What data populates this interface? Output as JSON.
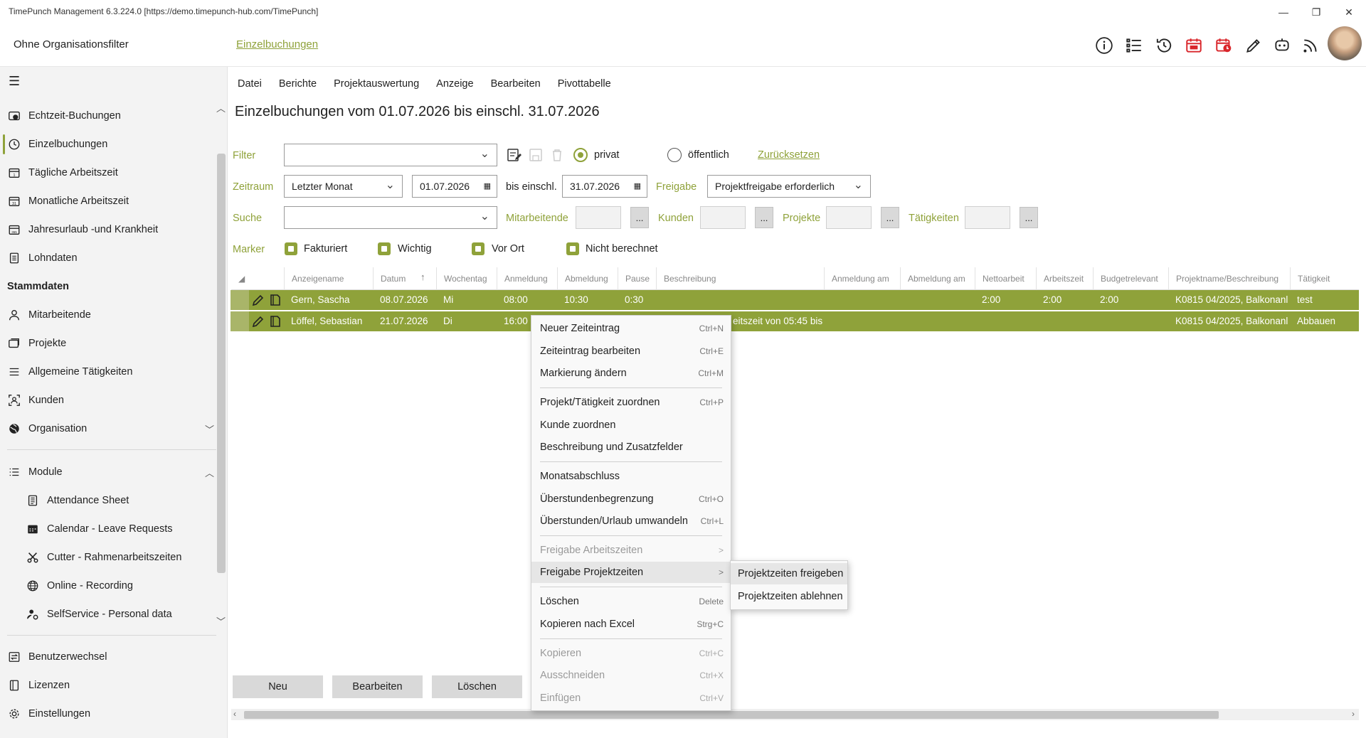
{
  "window": {
    "title": "TimePunch Management 6.3.224.0 [https://demo.timepunch-hub.com/TimePunch]",
    "buttons": [
      "—",
      "❐",
      "✕"
    ]
  },
  "header": {
    "org_filter": "Ohne Organisationsfilter",
    "breadcrumb": "Einzelbuchungen",
    "icons": [
      "info-icon",
      "list-icon",
      "history-icon",
      "calendar-alert-icon",
      "clock-alert-icon",
      "pencil-icon",
      "robot-icon",
      "rss-icon"
    ]
  },
  "sidebar": {
    "items": [
      {
        "label": "Echtzeit-Buchungen",
        "icon": "realtime-icon"
      },
      {
        "label": "Einzelbuchungen",
        "icon": "clock-icon"
      },
      {
        "label": "Tägliche Arbeitszeit",
        "icon": "calendar-day-icon"
      },
      {
        "label": "Monatliche Arbeitszeit",
        "icon": "calendar-month-icon"
      },
      {
        "label": "Jahresurlaub -und Krankheit",
        "icon": "calendar-year-icon"
      },
      {
        "label": "Lohndaten",
        "icon": "document-icon"
      }
    ],
    "stammdaten_header": "Stammdaten",
    "stammdaten": [
      {
        "label": "Mitarbeitende",
        "icon": "person-icon"
      },
      {
        "label": "Projekte",
        "icon": "projects-icon"
      },
      {
        "label": "Allgemeine Tätigkeiten",
        "icon": "list-icon"
      },
      {
        "label": "Kunden",
        "icon": "customer-icon"
      },
      {
        "label": "Organisation",
        "icon": "globe-icon"
      }
    ],
    "module_header": "Module",
    "modules": [
      {
        "label": "Attendance Sheet",
        "icon": "sheet-icon"
      },
      {
        "label": "Calendar - Leave Requests",
        "icon": "calendar-icon"
      },
      {
        "label": "Cutter - Rahmenarbeitszeiten",
        "icon": "scissors-icon"
      },
      {
        "label": "Online - Recording",
        "icon": "globe-icon"
      },
      {
        "label": "SelfService - Personal data",
        "icon": "person-gear-icon"
      }
    ],
    "bottom": [
      {
        "label": "Benutzerwechsel",
        "icon": "switch-user-icon"
      },
      {
        "label": "Lizenzen",
        "icon": "license-icon"
      },
      {
        "label": "Einstellungen",
        "icon": "gear-icon"
      }
    ]
  },
  "menu": [
    "Datei",
    "Berichte",
    "Projektauswertung",
    "Anzeige",
    "Bearbeiten",
    "Pivottabelle"
  ],
  "page_title": "Einzelbuchungen vom 01.07.2026 bis einschl. 31.07.2026",
  "filter": {
    "filter_label": "Filter",
    "filter_value": "",
    "radio_private": "privat",
    "radio_public": "öffentlich",
    "reset": "Zurücksetzen",
    "zeitraum_label": "Zeitraum",
    "zeitraum_value": "Letzter Monat",
    "date_from": "01.07.2026",
    "bis": "bis einschl.",
    "date_to": "31.07.2026",
    "freigabe_label": "Freigabe",
    "freigabe_value": "Projektfreigabe erforderlich",
    "suche_label": "Suche",
    "suche_value": "",
    "mitarbeitende_label": "Mitarbeitende",
    "kunden_label": "Kunden",
    "projekte_label": "Projekte",
    "taetigkeiten_label": "Tätigkeiten",
    "dots": "...",
    "marker_label": "Marker",
    "markers": [
      "Fakturiert",
      "Wichtig",
      "Vor Ort",
      "Nicht berechnet"
    ]
  },
  "grid": {
    "columns": [
      "Anzeigename",
      "Datum",
      "Wochentag",
      "Anmeldung",
      "Abmeldung",
      "Pause",
      "Beschreibung",
      "Anmeldung am",
      "Abmeldung am",
      "Nettoarbeit",
      "Arbeitszeit",
      "Budgetrelevant",
      "Projektname/Beschreibung",
      "Tätigkeit"
    ],
    "sort_arrow": "↑",
    "rows": [
      {
        "name": "Gern, Sascha",
        "date": "08.07.2026",
        "day": "Mi",
        "start": "08:00",
        "end": "10:30",
        "pause": "0:30",
        "desc": "",
        "netto": "2:00",
        "arbeit": "2:00",
        "budget": "2:00",
        "project": "K0815 04/2025, Balkonanl",
        "task": "test"
      },
      {
        "name": "Löffel, Sebastian",
        "date": "21.07.2026",
        "day": "Di",
        "start": "16:00",
        "end": "",
        "pause": "",
        "desc": "eitszeit von 05:45 bis ",
        "netto": "",
        "arbeit": "",
        "budget": "",
        "project": "K0815 04/2025, Balkonanl",
        "task": "Abbauen"
      }
    ]
  },
  "buttons": {
    "new": "Neu",
    "edit": "Bearbeiten",
    "delete": "Löschen"
  },
  "context_menu": {
    "items": [
      {
        "label": "Neuer Zeiteintrag",
        "shortcut": "Ctrl+N"
      },
      {
        "label": "Zeiteintrag bearbeiten",
        "shortcut": "Ctrl+E"
      },
      {
        "label": "Markierung ändern",
        "shortcut": "Ctrl+M"
      },
      {
        "label": "Projekt/Tätigkeit zuordnen",
        "shortcut": "Ctrl+P"
      },
      {
        "label": "Kunde zuordnen",
        "shortcut": ""
      },
      {
        "label": "Beschreibung und Zusatzfelder",
        "shortcut": ""
      },
      {
        "label": "Monatsabschluss",
        "shortcut": ""
      },
      {
        "label": "Überstundenbegrenzung",
        "shortcut": "Ctrl+O"
      },
      {
        "label": "Überstunden/Urlaub umwandeln",
        "shortcut": "Ctrl+L"
      },
      {
        "label": "Freigabe Arbeitszeiten",
        "shortcut": ">"
      },
      {
        "label": "Freigabe Projektzeiten",
        "shortcut": ">"
      },
      {
        "label": "Löschen",
        "shortcut": "Delete"
      },
      {
        "label": "Kopieren nach Excel",
        "shortcut": "Strg+C"
      },
      {
        "label": "Kopieren",
        "shortcut": "Ctrl+C"
      },
      {
        "label": "Ausschneiden",
        "shortcut": "Ctrl+X"
      },
      {
        "label": "Einfügen",
        "shortcut": "Ctrl+V"
      }
    ],
    "submenu": [
      "Projektzeiten freigeben",
      "Projektzeiten ablehnen"
    ]
  },
  "colors": {
    "accent": "#8fa23a",
    "alert": "#d9262b"
  }
}
